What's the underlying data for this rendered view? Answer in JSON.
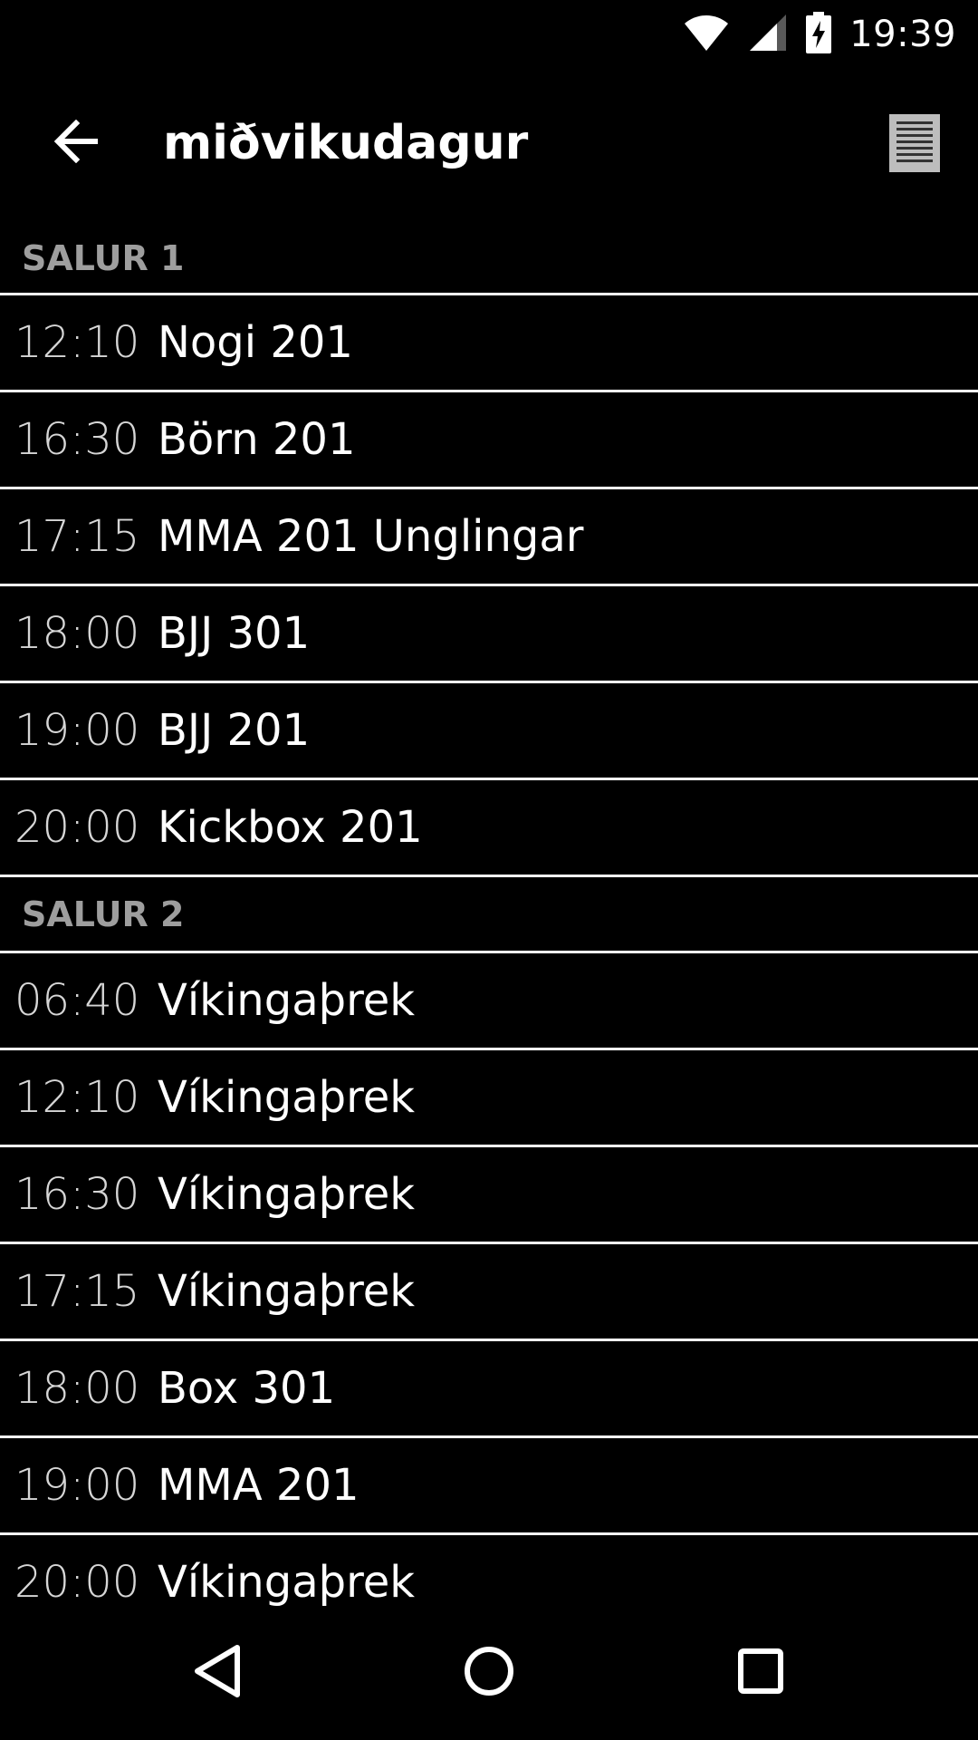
{
  "status_bar": {
    "time": "19:39",
    "icons": [
      "wifi-icon",
      "signal-icon",
      "battery-charging-icon"
    ]
  },
  "app_bar": {
    "title": "miðvikudagur",
    "back_icon": "arrow-back-icon",
    "list_icon": "list-view-icon"
  },
  "sections": [
    {
      "header": "SALUR 1",
      "items": [
        {
          "time": "12:10",
          "name": "Nogi 201"
        },
        {
          "time": "16:30",
          "name": "Börn 201"
        },
        {
          "time": "17:15",
          "name": "MMA 201 Unglingar"
        },
        {
          "time": "18:00",
          "name": "BJJ 301"
        },
        {
          "time": "19:00",
          "name": "BJJ 201"
        },
        {
          "time": "20:00",
          "name": "Kickbox 201"
        }
      ]
    },
    {
      "header": "SALUR 2",
      "items": [
        {
          "time": "06:40",
          "name": "Víkingaþrek"
        },
        {
          "time": "12:10",
          "name": "Víkingaþrek"
        },
        {
          "time": "16:30",
          "name": "Víkingaþrek"
        },
        {
          "time": "17:15",
          "name": "Víkingaþrek"
        },
        {
          "time": "18:00",
          "name": "Box 301"
        },
        {
          "time": "19:00",
          "name": "MMA 201"
        },
        {
          "time": "20:00",
          "name": "Víkingaþrek"
        }
      ]
    }
  ],
  "nav_bar": {
    "buttons": [
      "back-triangle-icon",
      "home-circle-icon",
      "recents-square-icon"
    ]
  },
  "colors": {
    "background": "#000000",
    "text": "#ffffff",
    "time_text": "#d6d6d6",
    "section_header": "#9e9e9e",
    "divider": "#ffffff"
  }
}
